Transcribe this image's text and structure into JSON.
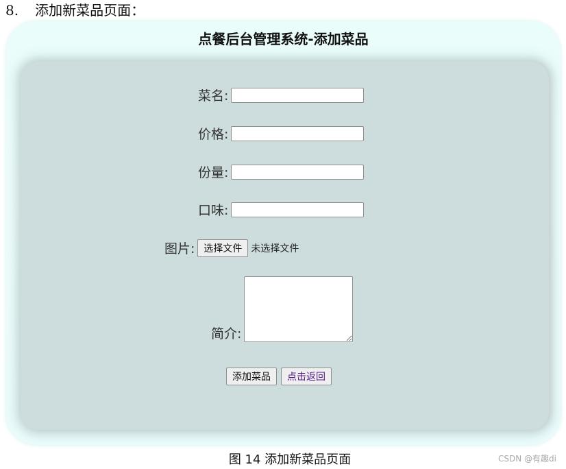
{
  "doc": {
    "heading_number": "8.",
    "heading_text": "添加新菜品页面：",
    "caption": "图 14 添加新菜品页面",
    "watermark": "CSDN @有趣di"
  },
  "app": {
    "title": "点餐后台管理系统-添加菜品"
  },
  "form": {
    "fields": [
      {
        "label": "菜名:",
        "value": ""
      },
      {
        "label": "价格:",
        "value": ""
      },
      {
        "label": "份量:",
        "value": ""
      },
      {
        "label": "口味:",
        "value": ""
      }
    ],
    "image": {
      "label": "图片:",
      "button_label": "选择文件",
      "status": "未选择文件"
    },
    "intro": {
      "label": "简介:",
      "value": ""
    },
    "buttons": {
      "submit_label": "添加菜品",
      "back_label": "点击返回"
    }
  }
}
